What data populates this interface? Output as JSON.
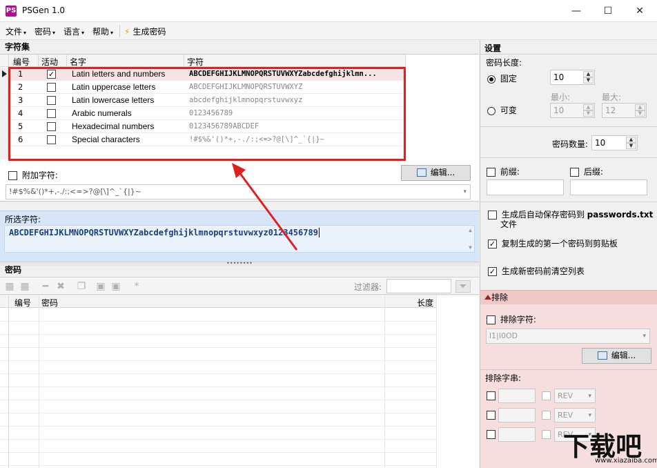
{
  "window": {
    "title": "PSGen 1.0",
    "icon_text": "PS",
    "min_glyph": "—",
    "max_glyph": "☐",
    "close_glyph": "✕"
  },
  "menu": {
    "items": [
      "文件",
      "密码",
      "语言",
      "帮助"
    ],
    "generate_label": "生成密码"
  },
  "charset": {
    "title": "字符集",
    "columns": [
      "编号",
      "活动",
      "名字",
      "字符"
    ],
    "rows": [
      {
        "no": "1",
        "active": "✓",
        "name": "Latin letters and numbers",
        "chars": "ABCDEFGHIJKLMNOPQRSTUVWXYZabcdefghijklmn...",
        "selected": true
      },
      {
        "no": "2",
        "active": "",
        "name": "Latin uppercase letters",
        "chars": "ABCDEFGHIJKLMNOPQRSTUVWXYZ"
      },
      {
        "no": "3",
        "active": "",
        "name": "Latin lowercase letters",
        "chars": "abcdefghijklmnopqrstuvwxyz"
      },
      {
        "no": "4",
        "active": "",
        "name": "Arabic numerals",
        "chars": "0123456789"
      },
      {
        "no": "5",
        "active": "",
        "name": "Hexadecimal numbers",
        "chars": "0123456789ABCDEF"
      },
      {
        "no": "6",
        "active": "",
        "name": "Special characters",
        "chars": "!#$%&'()*+,-./:;<=>?@[\\]^_`{|}~"
      }
    ],
    "extra_label": "附加字符:",
    "extra_edit_label": "编辑...",
    "extra_value": "!#$%&'()*+,-./:;<=>?@[\\]^_`{|}~"
  },
  "selected_chars": {
    "label": "所选字符:",
    "value": "ABCDEFGHIJKLMNOPQRSTUVWXYZabcdefghijklmnopqrstuvwxyz0123456789"
  },
  "passwords": {
    "title": "密码",
    "filter_label": "过滤器:",
    "columns": [
      "编号",
      "密码",
      "长度"
    ]
  },
  "settings": {
    "title": "设置",
    "length_label": "密码长度:",
    "fixed_label": "固定",
    "fixed_value": "10",
    "min_label": "最小:",
    "max_label": "最大:",
    "variable_label": "可变",
    "min_value": "10",
    "max_value": "12",
    "count_label": "密码数量:",
    "count_value": "10",
    "prefix_label": "前缀:",
    "suffix_label": "后缀:",
    "autosave_label": "生成后自动保存密码到",
    "autosave_file": "passwords.txt",
    "autosave_suffix": "文件",
    "copy_label": "复制生成的第一个密码到剪贴板",
    "clear_label": "生成新密码前清空列表"
  },
  "exclude": {
    "title": "排除",
    "chars_label": "排除字符:",
    "chars_value": "l1|I0OD",
    "edit_label": "编辑...",
    "strings_label": "排除字串:",
    "rev_rows": [
      "REV",
      "REV",
      "REV"
    ]
  },
  "watermark": {
    "big": "下载吧",
    "small": "www.xiazaiba.com"
  },
  "colors": {
    "highlight_red": "#e02020",
    "selected_row": "#f6e4e4",
    "selected_panel": "#d6e6f8",
    "exclude_panel": "#f6dede"
  }
}
